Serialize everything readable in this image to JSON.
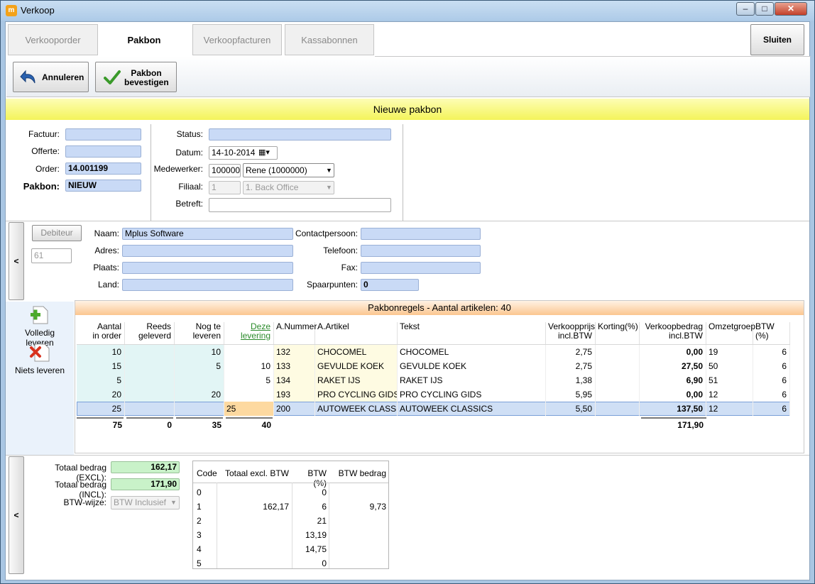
{
  "window": {
    "title": "Verkoop",
    "app_icon": "m",
    "minimize": "–",
    "maximize": "□",
    "close": "✕"
  },
  "tabs": [
    {
      "label": "Verkooporder"
    },
    {
      "label": "Pakbon"
    },
    {
      "label": "Verkoopfacturen"
    },
    {
      "label": "Kassabonnen"
    }
  ],
  "close_button": "Sluiten",
  "toolbar": {
    "cancel_label": "Annuleren",
    "confirm_label_1": "Pakbon",
    "confirm_label_2": "bevestigen"
  },
  "header": {
    "title": "Nieuwe pakbon"
  },
  "left_info": {
    "factuur_label": "Factuur:",
    "factuur": "",
    "offerte_label": "Offerte:",
    "offerte": "",
    "order_label": "Order:",
    "order": "14.001199",
    "pakbon_label": "Pakbon:",
    "pakbon": "NIEUW"
  },
  "mid_info": {
    "status_label": "Status:",
    "status": "",
    "datum_label": "Datum:",
    "datum": "14-10-2014",
    "medewerker_label": "Medewerker:",
    "medewerker_code": "1000000",
    "medewerker_name": "Rene (1000000)",
    "filiaal_label": "Filiaal:",
    "filiaal_code": "1",
    "filiaal_name": "1. Back Office",
    "betreft_label": "Betreft:",
    "betreft": ""
  },
  "customer": {
    "collapse": "<",
    "debiteur_button": "Debiteur",
    "debiteur_number": "61",
    "naam_label": "Naam:",
    "naam": "Mplus Software",
    "adres_label": "Adres:",
    "adres": "",
    "plaats_label": "Plaats:",
    "plaats": "",
    "land_label": "Land:",
    "land": "",
    "contact_label": "Contactpersoon:",
    "contact": "",
    "telefoon_label": "Telefoon:",
    "telefoon": "",
    "fax_label": "Fax:",
    "fax": "",
    "spaarpunten_label": "Spaarpunten:",
    "spaarpunten": "0"
  },
  "actions": {
    "deliver_all": "Volledig leveren",
    "deliver_none": "Niets leveren"
  },
  "lines": {
    "title": "Pakbonregels - Aantal artikelen: 40",
    "headers": {
      "aantal_1": "Aantal",
      "aantal_2": "in order",
      "reeds_1": "Reeds",
      "reeds_2": "geleverd",
      "nog_1": "Nog te",
      "nog_2": "leveren",
      "deze_1": "Deze",
      "deze_2": "levering",
      "anummer": "A.Nummer",
      "aartikel": "A.Artikel",
      "tekst": "Tekst",
      "prijs_1": "Verkoopprijs",
      "prijs_2": "incl.BTW",
      "korting": "Korting(%)",
      "bedrag_1": "Verkoopbedrag",
      "bedrag_2": "incl.BTW",
      "omzet": "Omzetgroep",
      "btw": "BTW (%)"
    },
    "rows": [
      {
        "aantal": "10",
        "reeds": "",
        "nog": "10",
        "deze": "",
        "anummer": "132",
        "aartikel": "CHOCOMEL",
        "tekst": "CHOCOMEL",
        "prijs": "2,75",
        "korting": "",
        "bedrag": "0,00",
        "omzet": "19",
        "btw": "6"
      },
      {
        "aantal": "15",
        "reeds": "",
        "nog": "5",
        "deze": "10",
        "anummer": "133",
        "aartikel": "GEVULDE KOEK",
        "tekst": "GEVULDE KOEK",
        "prijs": "2,75",
        "korting": "",
        "bedrag": "27,50",
        "omzet": "50",
        "btw": "6"
      },
      {
        "aantal": "5",
        "reeds": "",
        "nog": "",
        "deze": "5",
        "anummer": "134",
        "aartikel": "RAKET IJS",
        "tekst": "RAKET IJS",
        "prijs": "1,38",
        "korting": "",
        "bedrag": "6,90",
        "omzet": "51",
        "btw": "6"
      },
      {
        "aantal": "20",
        "reeds": "",
        "nog": "20",
        "deze": "",
        "anummer": "193",
        "aartikel": "PRO CYCLING GIDS",
        "tekst": "PRO CYCLING GIDS",
        "prijs": "5,95",
        "korting": "",
        "bedrag": "0,00",
        "omzet": "12",
        "btw": "6"
      },
      {
        "aantal": "25",
        "reeds": "",
        "nog": "",
        "deze": "25",
        "anummer": "200",
        "aartikel": "AUTOWEEK CLASSICS",
        "tekst": "AUTOWEEK CLASSICS",
        "prijs": "5,50",
        "korting": "",
        "bedrag": "137,50",
        "omzet": "12",
        "btw": "6"
      }
    ],
    "totals": {
      "aantal": "75",
      "reeds": "0",
      "nog": "35",
      "deze": "40",
      "bedrag": "171,90"
    }
  },
  "totals": {
    "collapse": "<",
    "excl_label": "Totaal bedrag (EXCL):",
    "excl": "162,17",
    "incl_label": "Totaal bedrag (INCL):",
    "incl": "171,90",
    "btw_wijze_label": "BTW-wijze:",
    "btw_wijze": "BTW Inclusief"
  },
  "btw_table": {
    "headers": {
      "code": "Code",
      "totaal": "Totaal excl. BTW",
      "perc": "BTW (%)",
      "bedrag": "BTW bedrag"
    },
    "rows": [
      {
        "code": "0",
        "totaal": "",
        "perc": "0",
        "bedrag": ""
      },
      {
        "code": "1",
        "totaal": "162,17",
        "perc": "6",
        "bedrag": "9,73"
      },
      {
        "code": "2",
        "totaal": "",
        "perc": "21",
        "bedrag": ""
      },
      {
        "code": "3",
        "totaal": "",
        "perc": "13,19",
        "bedrag": ""
      },
      {
        "code": "4",
        "totaal": "",
        "perc": "14,75",
        "bedrag": ""
      },
      {
        "code": "5",
        "totaal": "",
        "perc": "0",
        "bedrag": ""
      }
    ]
  },
  "colors": {
    "field_blue": "#c9daf6",
    "header_yellow": "#f4f45a",
    "lines_orange": "#fbc690",
    "qty_cyan": "#e2f5f5",
    "article_yellow": "#fefbe2",
    "selected_row": "#cfdff5",
    "edit_cell": "#fdd9a0",
    "total_green": "#c9f2c9"
  }
}
